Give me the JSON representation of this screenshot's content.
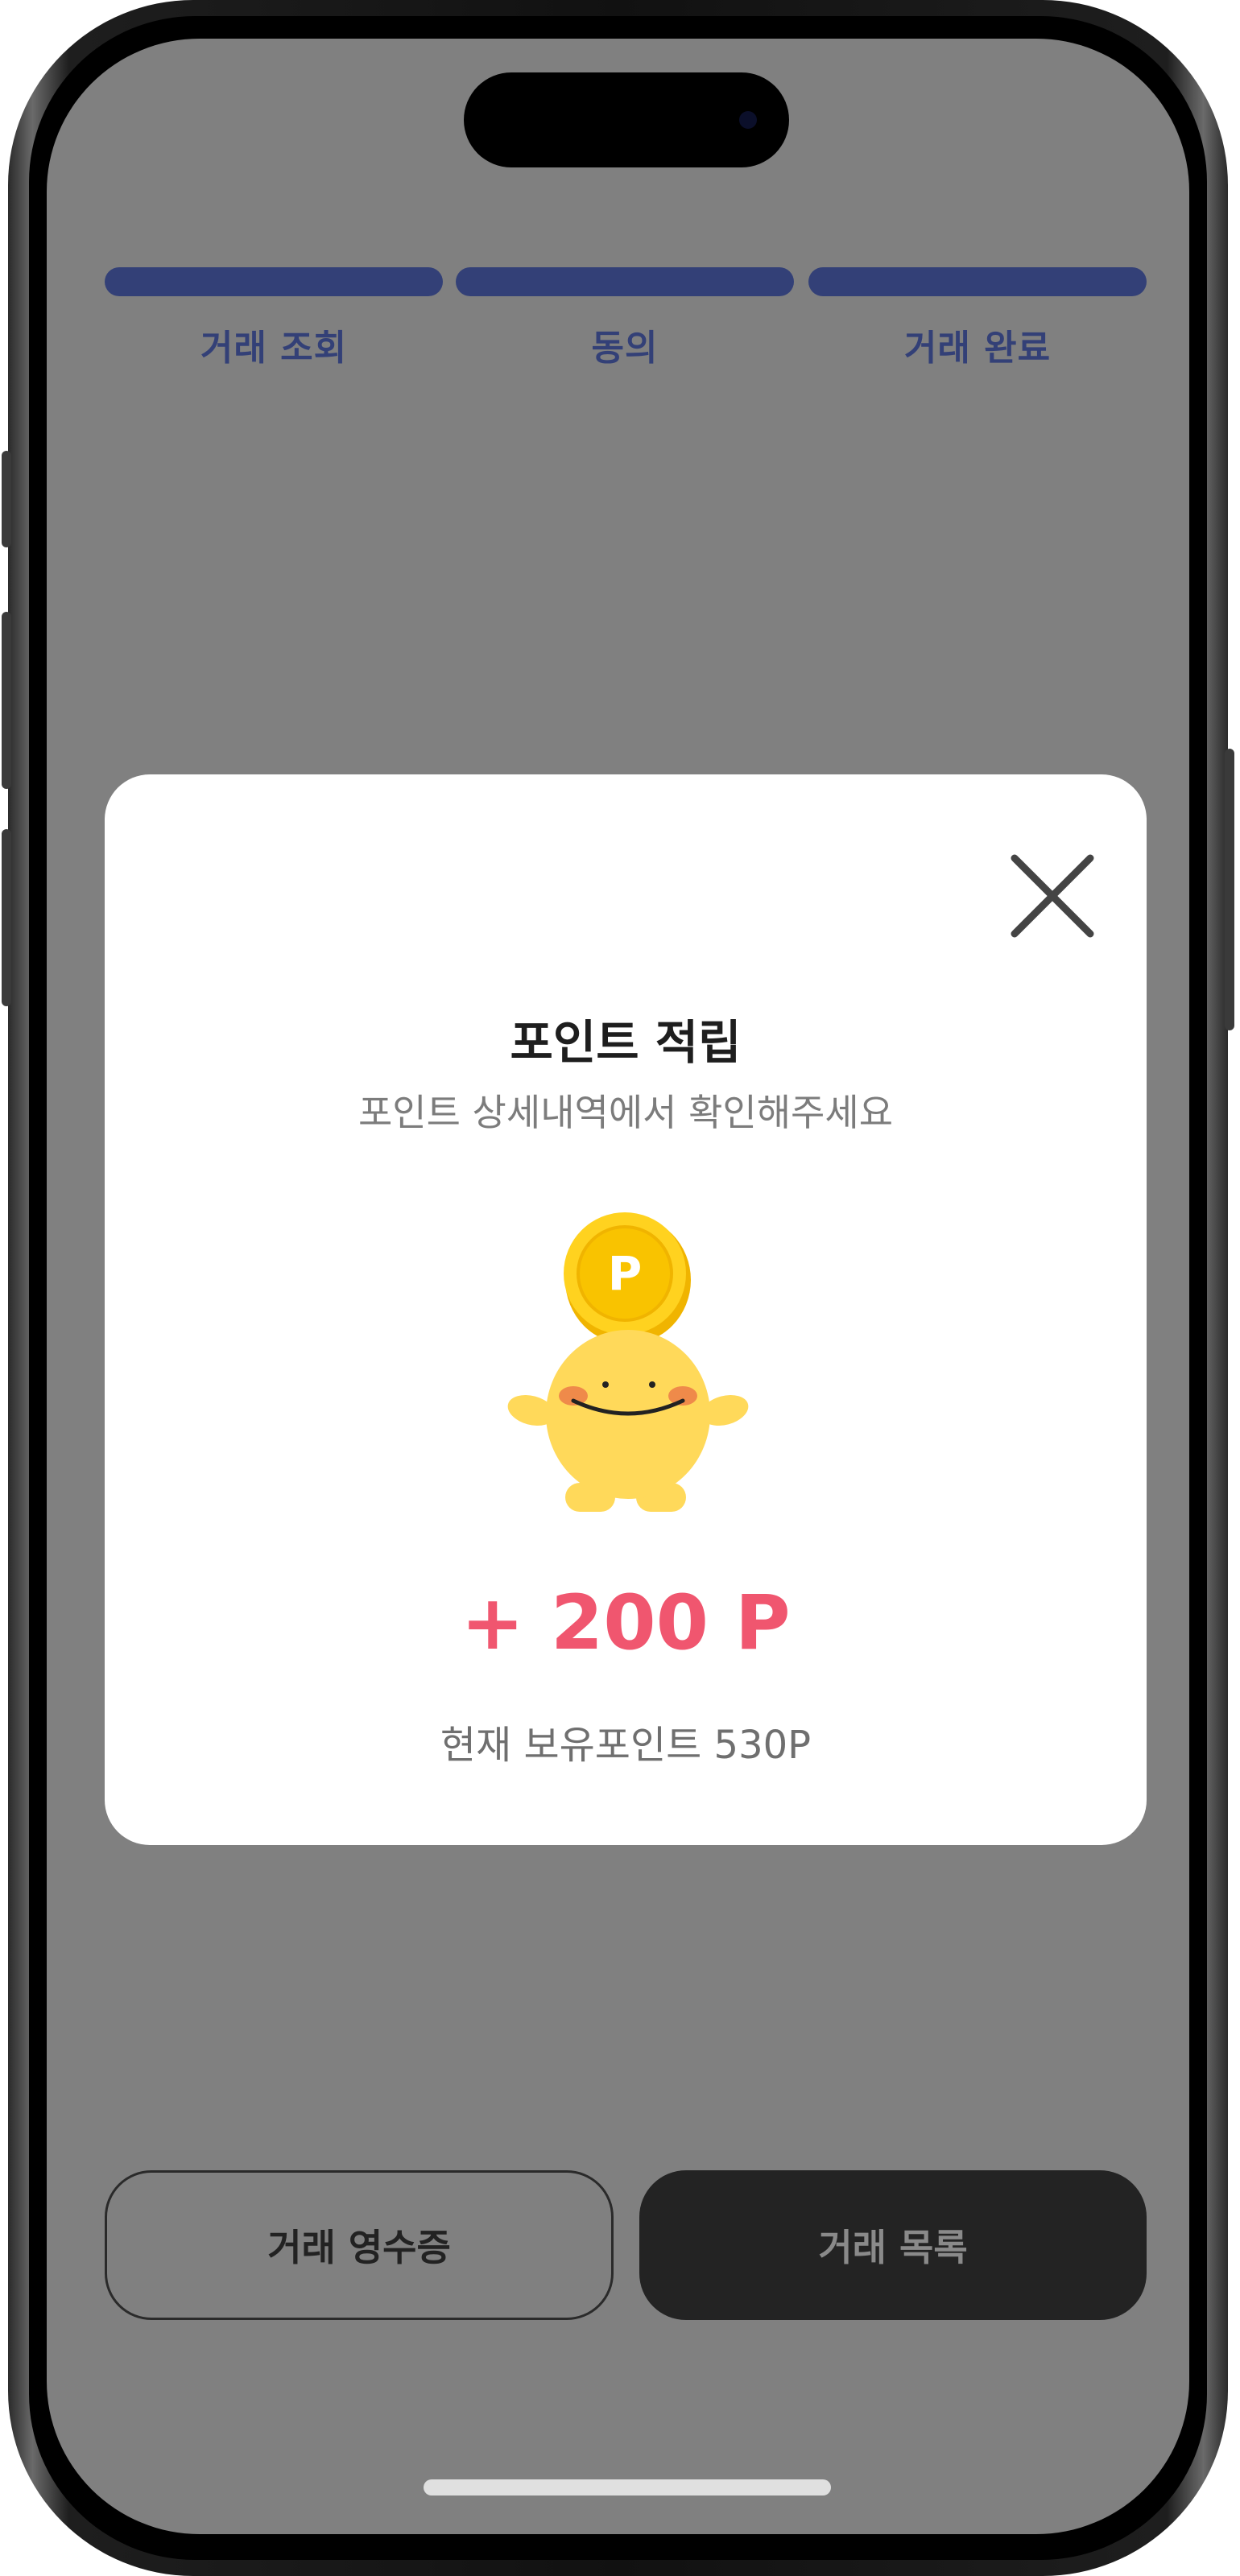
{
  "stepper": {
    "steps": [
      {
        "label": "거래 조회"
      },
      {
        "label": "동의"
      },
      {
        "label": "거래 완료"
      }
    ],
    "active_color": "#334077"
  },
  "modal": {
    "title": "포인트 적립",
    "subtitle": "포인트 상세내역에서 확인해주세요",
    "coin_letter": "P",
    "points_earned": "+ 200 P",
    "current_points": "현재 보유포인트 530P",
    "close_icon": "close-icon",
    "accent_color": "#f0566f"
  },
  "actions": {
    "receipt_label": "거래 영수증",
    "list_label": "거래 목록"
  }
}
